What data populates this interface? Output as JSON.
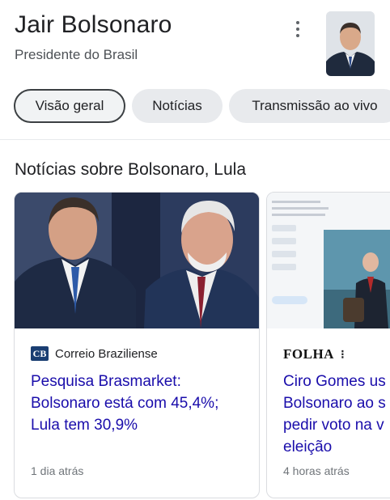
{
  "header": {
    "title": "Jair Bolsonaro",
    "subtitle": "Presidente do Brasil"
  },
  "tabs": [
    {
      "label": "Visão geral",
      "active": true
    },
    {
      "label": "Notícias",
      "active": false
    },
    {
      "label": "Transmissão ao vivo",
      "active": false
    }
  ],
  "news_section": {
    "title": "Notícias sobre Bolsonaro, Lula",
    "cards": [
      {
        "source": "Correio Braziliense",
        "source_logo_text": "CB",
        "headline_lines": [
          "Pesquisa Brasmarket:",
          "Bolsonaro está com 45,4%;",
          "Lula tem 30,9%"
        ],
        "time": "1 dia atrás"
      },
      {
        "source_logo_text": "FOLHA",
        "headline_lines": [
          "Ciro Gomes us",
          "Bolsonaro ao s",
          "pedir voto na v",
          "eleição"
        ],
        "time": "4 horas atrás"
      }
    ]
  },
  "colors": {
    "headline_link": "#1a0dab",
    "chip_bg": "#e8eaed",
    "cb_logo_bg": "#1a3e72"
  }
}
